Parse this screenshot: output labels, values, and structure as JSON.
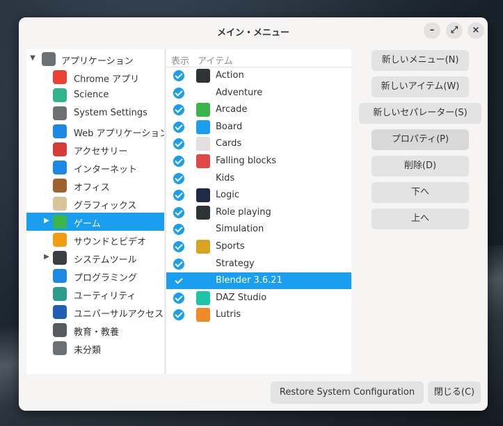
{
  "window": {
    "title": "メイン・メニュー"
  },
  "window_controls": {
    "minimize": "–",
    "maximize": "⤢",
    "close": "×"
  },
  "categories": [
    {
      "label": "アプリケーション",
      "expander": "▼",
      "icon": "gear-icon",
      "color": "#6b7075"
    },
    {
      "label": "Chrome アプリ",
      "expander": "",
      "icon": "chrome-icon",
      "color": "#e94235"
    },
    {
      "label": "Science",
      "expander": "",
      "icon": "flask-icon",
      "color": "#2fb58a"
    },
    {
      "label": "System Settings",
      "expander": "",
      "icon": "gear-icon",
      "color": "#6b7075"
    },
    {
      "label": "Web アプリケーション",
      "expander": "",
      "icon": "cloud-icon",
      "color": "#1e88e5"
    },
    {
      "label": "アクセサリー",
      "expander": "",
      "icon": "toolbox-icon",
      "color": "#d83a3a"
    },
    {
      "label": "インターネット",
      "expander": "",
      "icon": "cloud-icon",
      "color": "#1e88e5"
    },
    {
      "label": "オフィス",
      "expander": "",
      "icon": "briefcase-icon",
      "color": "#a0622d"
    },
    {
      "label": "グラフィックス",
      "expander": "",
      "icon": "palette-icon",
      "color": "#d9c49a"
    },
    {
      "label": "ゲーム",
      "expander": "▶",
      "icon": "gamepad-icon",
      "color": "#3bb54a",
      "selected": true
    },
    {
      "label": "サウンドとビデオ",
      "expander": "",
      "icon": "music-icon",
      "color": "#f39c12"
    },
    {
      "label": "システムツール",
      "expander": "▶",
      "icon": "monitor-icon",
      "color": "#3a3f44"
    },
    {
      "label": "プログラミング",
      "expander": "",
      "icon": "code-icon",
      "color": "#1e88e5"
    },
    {
      "label": "ユーティリティ",
      "expander": "",
      "icon": "utility-icon",
      "color": "#2a9d8f"
    },
    {
      "label": "ユニバーサルアクセス",
      "expander": "",
      "icon": "accessibility-icon",
      "color": "#1e5fb4"
    },
    {
      "label": "教育・教養",
      "expander": "",
      "icon": "education-icon",
      "color": "#555b61"
    },
    {
      "label": "未分類",
      "expander": "",
      "icon": "gear-icon",
      "color": "#6b7075"
    }
  ],
  "items_table": {
    "headers": {
      "show": "表示",
      "item": "アイテム"
    },
    "rows": [
      {
        "label": "Action",
        "icon": "action-icon",
        "checked": true,
        "color": "#2e3436"
      },
      {
        "label": "Adventure",
        "icon": "",
        "checked": true,
        "color": ""
      },
      {
        "label": "Arcade",
        "icon": "gamepad-icon",
        "checked": true,
        "color": "#3bb54a"
      },
      {
        "label": "Board",
        "icon": "board-icon",
        "checked": true,
        "color": "#1a9ff0"
      },
      {
        "label": "Cards",
        "icon": "cards-icon",
        "checked": true,
        "color": "#e0e0e0"
      },
      {
        "label": "Falling blocks",
        "icon": "blocks-icon",
        "checked": true,
        "color": "#e04848"
      },
      {
        "label": "Kids",
        "icon": "",
        "checked": true,
        "color": ""
      },
      {
        "label": "Logic",
        "icon": "gears-icon",
        "checked": true,
        "color": "#1f2a44"
      },
      {
        "label": "Role playing",
        "icon": "person-icon",
        "checked": true,
        "color": "#2e3436"
      },
      {
        "label": "Simulation",
        "icon": "",
        "checked": true,
        "color": ""
      },
      {
        "label": "Sports",
        "icon": "trophy-icon",
        "checked": true,
        "color": "#d9a520"
      },
      {
        "label": "Strategy",
        "icon": "",
        "checked": true,
        "color": ""
      },
      {
        "label": "Blender 3.6.21",
        "icon": "",
        "checked": true,
        "color": "",
        "selected": true
      },
      {
        "label": "DAZ Studio",
        "icon": "daz-icon",
        "checked": true,
        "color": "#19c6a6"
      },
      {
        "label": "Lutris",
        "icon": "lutris-icon",
        "checked": true,
        "color": "#f08a24"
      }
    ]
  },
  "side_buttons": {
    "new_menu": "新しいメニュー(N)",
    "new_item": "新しいアイテム(W)",
    "new_separator": "新しいセパレーター(S)",
    "properties": "プロパティ(P)",
    "delete": "削除(D)",
    "move_down": "下へ",
    "move_up": "上へ"
  },
  "footer": {
    "restore": "Restore System Configuration",
    "close": "閉じる(C)"
  },
  "colors": {
    "accent": "#1a9ff0",
    "window_bg": "#f6f5f4"
  }
}
